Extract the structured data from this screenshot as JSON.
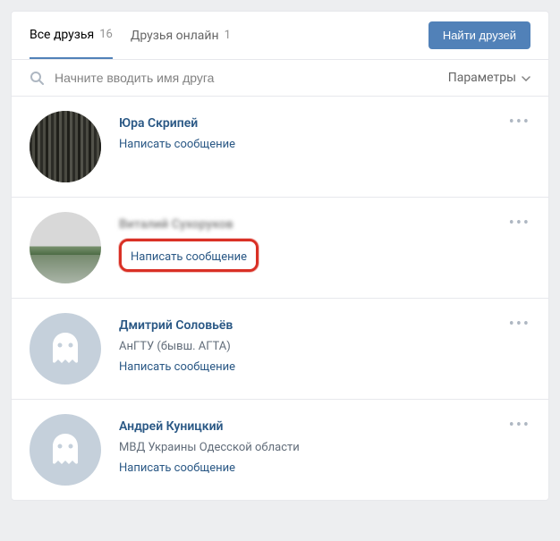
{
  "tabs": {
    "all_friends": {
      "label": "Все друзья",
      "count": "16"
    },
    "online": {
      "label": "Друзья онлайн",
      "count": "1"
    }
  },
  "actions": {
    "find_friends": "Найти друзей",
    "parameters": "Параметры"
  },
  "search": {
    "placeholder": "Начните вводить имя друга"
  },
  "friends": [
    {
      "name": "Юра Скрипей",
      "meta": "",
      "write": "Написать сообщение"
    },
    {
      "name": "Виталий Сухоруков",
      "meta": "",
      "write": "Написать сообщение"
    },
    {
      "name": "Дмитрий Соловьёв",
      "meta": "АнГТУ (бывш. АГТА)",
      "write": "Написать сообщение"
    },
    {
      "name": "Андрей Куницкий",
      "meta": "МВД Украины Одесской области",
      "write": "Написать сообщение"
    }
  ]
}
